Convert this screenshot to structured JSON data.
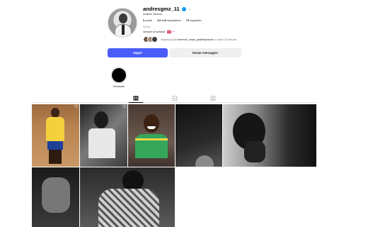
{
  "profile": {
    "username": "andresgmz_11",
    "full_name": "Andrés Gómez",
    "stats": {
      "posts_value": "5",
      "posts_label": "posts",
      "followers_value": "111 mil",
      "followers_label": "seguidores",
      "following_value": "78",
      "following_label": "seguindo"
    },
    "category": "Sports",
    "bio": "siempre fui soñador"
  },
  "followed_by": {
    "prefix": "Seguido(a) por",
    "names": "fortnestx1, yeass_gratefullyforbcts,",
    "suffix": "e outras 34 pessoas"
  },
  "actions": {
    "follow_label": "Seguir",
    "message_label": "Enviar mensagem"
  },
  "highlights": [
    {
      "label": "Destacado"
    }
  ],
  "tabs": [
    {
      "icon": "grid-icon",
      "active": true
    },
    {
      "icon": "reels-icon",
      "active": false
    },
    {
      "icon": "tagged-icon",
      "active": false
    }
  ],
  "colors": {
    "follow_button": "#4a5df9",
    "verified": "#0095f6"
  },
  "posts": [
    {
      "name": "post-yellow-jersey-kid",
      "multi": true
    },
    {
      "name": "post-bw-kid-smiling",
      "multi": true
    },
    {
      "name": "post-green-jersey-kid",
      "multi": false
    },
    {
      "name": "post-dark-closeup",
      "multi": false
    },
    {
      "name": "post-bw-profile",
      "multi": false
    },
    {
      "name": "post-hands",
      "multi": false
    },
    {
      "name": "post-patterned-cloth",
      "multi": false
    }
  ]
}
